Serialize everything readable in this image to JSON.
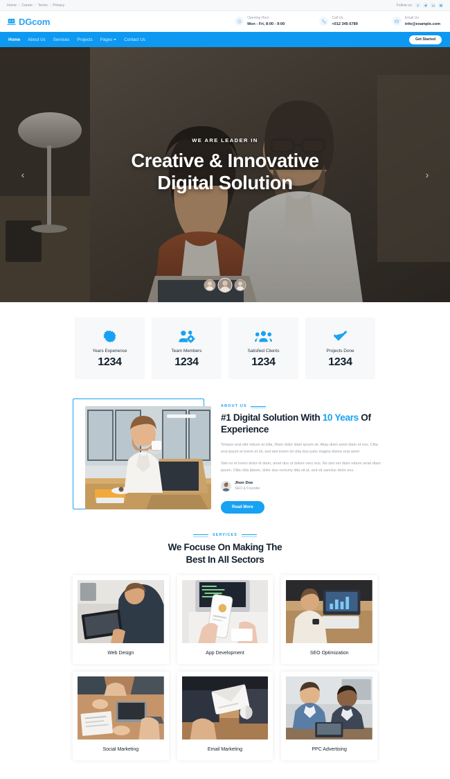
{
  "topbar": {
    "links": [
      {
        "label": "Home"
      },
      {
        "label": "Career"
      },
      {
        "label": "Terms"
      },
      {
        "label": "Privacy"
      }
    ],
    "separator": "/",
    "follow_label": "Follow us:",
    "socials": [
      {
        "name": "facebook-icon",
        "glyph": "f"
      },
      {
        "name": "twitter-icon",
        "glyph": "t"
      },
      {
        "name": "linkedin-icon",
        "glyph": "in"
      },
      {
        "name": "instagram-icon",
        "glyph": "ig"
      }
    ]
  },
  "header": {
    "brand": "DGcom",
    "brand_icon": "laptop-code-icon",
    "accent_color": "#17a2f3",
    "info": [
      {
        "icon": "clock-icon",
        "label": "Opening Hour",
        "value": "Mon - Fri, 8:00 - 9:00"
      },
      {
        "icon": "phone-icon",
        "label": "Call Us",
        "value": "+012 345 6789"
      },
      {
        "icon": "envelope-icon",
        "label": "Email Us",
        "value": "info@example.com"
      }
    ]
  },
  "nav": {
    "background": "#0d99f2",
    "items": [
      {
        "label": "Home",
        "active": true,
        "dropdown": false
      },
      {
        "label": "About Us",
        "active": false,
        "dropdown": false
      },
      {
        "label": "Services",
        "active": false,
        "dropdown": false
      },
      {
        "label": "Projects",
        "active": false,
        "dropdown": false
      },
      {
        "label": "Pages",
        "active": false,
        "dropdown": true
      },
      {
        "label": "Contact Us",
        "active": false,
        "dropdown": false
      }
    ],
    "cta_label": "Get Started"
  },
  "hero": {
    "kicker": "WE ARE LEADER IN",
    "title_line1": "Creative & Innovative",
    "title_line2": "Digital Solution",
    "prev_glyph": "‹",
    "next_glyph": "›",
    "thumbs": [
      {
        "selected": false
      },
      {
        "selected": true
      },
      {
        "selected": false
      }
    ]
  },
  "stats": [
    {
      "icon": "badge-star-icon",
      "label": "Years Experience",
      "value": "1234"
    },
    {
      "icon": "users-cog-icon",
      "label": "Team Members",
      "value": "1234"
    },
    {
      "icon": "users-icon",
      "label": "Satisfied Clients",
      "value": "1234"
    },
    {
      "icon": "check-icon",
      "label": "Projects Done",
      "value": "1234"
    }
  ],
  "about": {
    "kicker": "ABOUT US",
    "heading_part1": "#1 Digital Solution With ",
    "heading_highlight1": "10",
    "heading_part2": " ",
    "heading_highlight2": "Years",
    "heading_part3": " Of Experience",
    "paragraph1": "Tempor erat elitr rebum at clita. Diam dolor diam ipsum sit. Aliqu diam amet diam et eos. Clita erat ipsum et lorem et sit, sed stet lorem sit clita duo justo magna dolore erat amet",
    "paragraph2": "Stet no et lorem dolor et diam, amet duo ut dolore vero eos. No stet est diam rebum amet diam ipsum. Clita clita labore, dolor duo nonumy dita sit at, sed sit sanctus dolor eos.",
    "author_name": "Jhon Doe",
    "author_role": "SEO & Founder",
    "button_label": "Read More"
  },
  "services": {
    "kicker": "SERVICES",
    "heading_line1": "We Focuse On Making The",
    "heading_line2": "Best In All Sectors",
    "cards": [
      {
        "name": "Web Design"
      },
      {
        "name": "App Development"
      },
      {
        "name": "SEO Optimization"
      },
      {
        "name": "Social Marketing"
      },
      {
        "name": "Email Marketing"
      },
      {
        "name": "PPC Advertising"
      }
    ]
  }
}
